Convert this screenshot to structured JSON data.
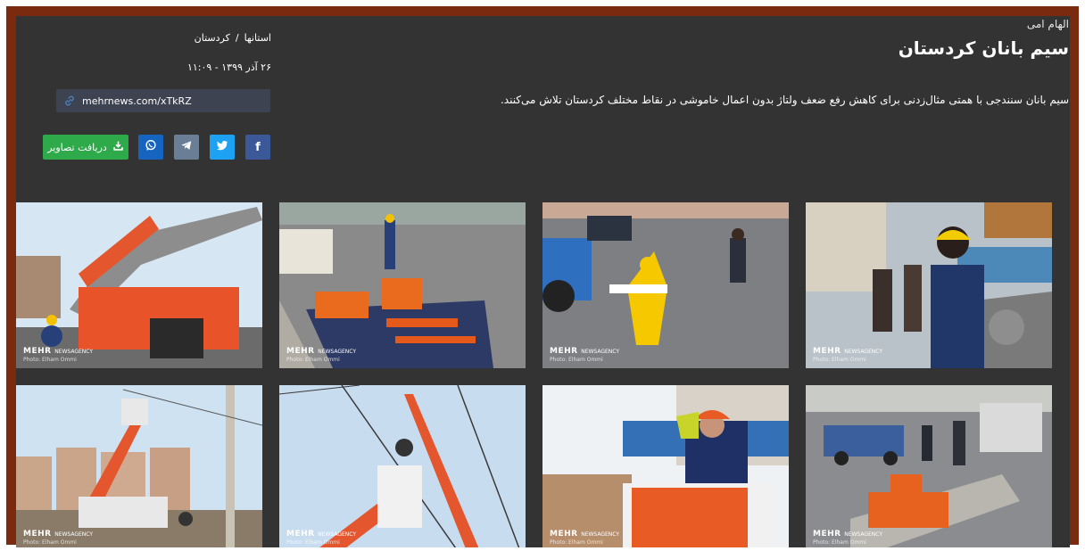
{
  "article": {
    "author": "الهام امی",
    "title": "سیم بانان کردستان",
    "lead": "سیم بانان سنندجی با همتی مثال‌زدنی برای کاهش رفع ضعف ولتاژ بدون اعمال خاموشی در نقاط مختلف کردستان تلاش می‌کنند."
  },
  "breadcrumb": {
    "section": "استانها",
    "separator": "/",
    "province": "کردستان"
  },
  "date": "۲۶ آذر ۱۳۹۹ - ۱۱:۰۹",
  "shortlink": {
    "icon": "link-icon",
    "text": "mehrnews.com/xTkRZ"
  },
  "share": {
    "facebook": {
      "icon": "facebook-icon",
      "glyph": "f",
      "color": "#3b5998"
    },
    "twitter": {
      "icon": "twitter-icon",
      "color": "#1da1f2"
    },
    "telegram": {
      "icon": "telegram-icon",
      "color": "#6a7f95"
    },
    "whatsapp": {
      "icon": "whatsapp-icon",
      "color": "#1565c0"
    },
    "download": {
      "icon": "download-icon",
      "label": "دریافت تصاویر",
      "color": "#2eaa4a"
    }
  },
  "gallery": {
    "watermark_brand": "MEHR",
    "watermark_agency": "NEWSAGENCY",
    "watermark_credit": "Photo: Elham Ommi",
    "photos": [
      {
        "subject": "orange crane truck with lineman in hard hat"
      },
      {
        "subject": "orange safety tools laid out on street"
      },
      {
        "subject": "yellow warning sign figure on road with photographer"
      },
      {
        "subject": "lineman in yellow helmet and blue uniform"
      },
      {
        "subject": "bucket truck lifting worker above apartments"
      },
      {
        "subject": "worker in orange bucket near power lines"
      },
      {
        "subject": "worker in orange helmet with face shield"
      },
      {
        "subject": "trucks and workers with equipment on sidewalk"
      }
    ]
  }
}
